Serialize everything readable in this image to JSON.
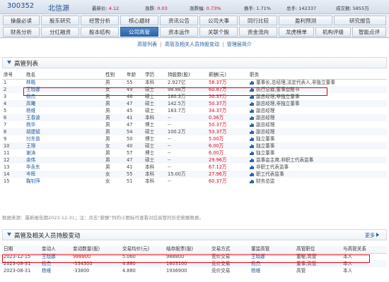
{
  "header": {
    "code": "300352",
    "name": "北信源",
    "quote": [
      {
        "label": "最新价:",
        "value": "4.12",
        "red": true
      },
      {
        "label": "涨跌:",
        "value": "0.03",
        "red": true
      },
      {
        "label": "涨跌幅:",
        "value": "0.73%",
        "red": true
      },
      {
        "label": "换手:",
        "value": "1.71%",
        "red": false
      },
      {
        "label": "总手:",
        "value": "142337",
        "red": false
      },
      {
        "label": "成交额:",
        "value": "5855万",
        "red": false
      }
    ]
  },
  "nav": {
    "row1": [
      "操盘必读",
      "股东研究",
      "经营分析",
      "核心题材",
      "资讯公告",
      "公司大事",
      "同行比较",
      "盈利预测",
      "研究报告"
    ],
    "row2": [
      "财务分析",
      "分红融资",
      "股本结构",
      "公司高管",
      "资本运作",
      "关联个股",
      "资金流向",
      "龙虎榜单",
      "机构评级",
      "智能点评"
    ],
    "active": "公司高管"
  },
  "subnav": {
    "items": [
      "高管列表",
      "高管及相关人员持股变动",
      "管理层简介"
    ],
    "sep": "|"
  },
  "managers": {
    "title": "高管列表",
    "headers": [
      "序号",
      "姓名",
      "性别",
      "年龄",
      "学历",
      "持股数(股)",
      "薪酬(元)",
      "职务"
    ],
    "rows": [
      [
        "1",
        "林皓",
        "男",
        "55",
        "本科",
        "2.927亿",
        "58.37万",
        "董事长,总经理,法定代表人,非独立董事"
      ],
      [
        "2",
        "王晓娜",
        "女",
        "49",
        "硕士",
        "98.88万",
        "60.87万",
        "执行总裁,董事会秘书"
      ],
      [
        "3",
        "杨杰",
        "男",
        "46",
        "硕士",
        "160.3万",
        "50.37万",
        "副总经理,非独立董事"
      ],
      [
        "4",
        "高曦",
        "男",
        "47",
        "硕士",
        "142.5万",
        "50.37万",
        "副总经理,非独立董事"
      ],
      [
        "5",
        "杨维",
        "男",
        "45",
        "硕士",
        "183.7万",
        "34.37万",
        "副总经理"
      ],
      [
        "6",
        "王春波",
        "男",
        "41",
        "本科",
        "--",
        "0.36万",
        "副总经理"
      ],
      [
        "7",
        "杨华",
        "男",
        "47",
        "博士",
        "--",
        "50.37万",
        "副总经理"
      ],
      [
        "8",
        "胡建斌",
        "男",
        "54",
        "硕士",
        "100.2万",
        "53.37万",
        "副总经理"
      ],
      [
        "9",
        "付东普",
        "男",
        "50",
        "博士",
        "--",
        "5.00万",
        "独立董事"
      ],
      [
        "10",
        "王理",
        "女",
        "40",
        "硕士",
        "--",
        "6.00万",
        "独立董事"
      ],
      [
        "11",
        "谢涛",
        "男",
        "57",
        "博士",
        "--",
        "6.00万",
        "独立董事"
      ],
      [
        "12",
        "余伟",
        "男",
        "47",
        "硕士",
        "--",
        "29.96万",
        "监事会主席,非职工代表监事"
      ],
      [
        "13",
        "毕永东",
        "男",
        "41",
        "本科",
        "--",
        "67.12万",
        "非职工代表监事"
      ],
      [
        "14",
        "岑晖",
        "女",
        "55",
        "本科",
        "15.00万",
        "27.96万",
        "职工代表监事"
      ],
      [
        "15",
        "鞠钊萍",
        "女",
        "51",
        "本科",
        "--",
        "60.37万",
        "财务总监"
      ]
    ]
  },
  "note": "数据来源：最新报告期2023-12-31；注：点击“薪酬”列的小图标可查看对应高管的历史薪酬数据。",
  "trades": {
    "title": "高管及相关人员持股变动",
    "more": "更多",
    "headers": [
      "日期",
      "变动人",
      "变动数量(股)",
      "交易均价(元)",
      "结存股票(股)",
      "交易方式",
      "董监高管",
      "高管职位",
      "与高管关系"
    ],
    "rows": [
      [
        "2023-12-15",
        "王晓娜",
        "988800",
        "5.060",
        "988800",
        "竞价交易",
        "王晓娜",
        "董秘,高管",
        "本人"
      ],
      [
        "2023-08-31",
        "杨杰",
        "-534300",
        "4.880",
        "1603100",
        "竞价交易",
        "杨杰",
        "董事,高管",
        "本人"
      ],
      [
        "2023-08-31",
        "杨维",
        "-33800",
        "4.880",
        "1936900",
        "竞价交易",
        "杨维",
        "高管",
        "本人"
      ]
    ]
  },
  "colors": {
    "accent": "#2d64a8",
    "highlight": "#e60012",
    "up": "#e3001b"
  }
}
